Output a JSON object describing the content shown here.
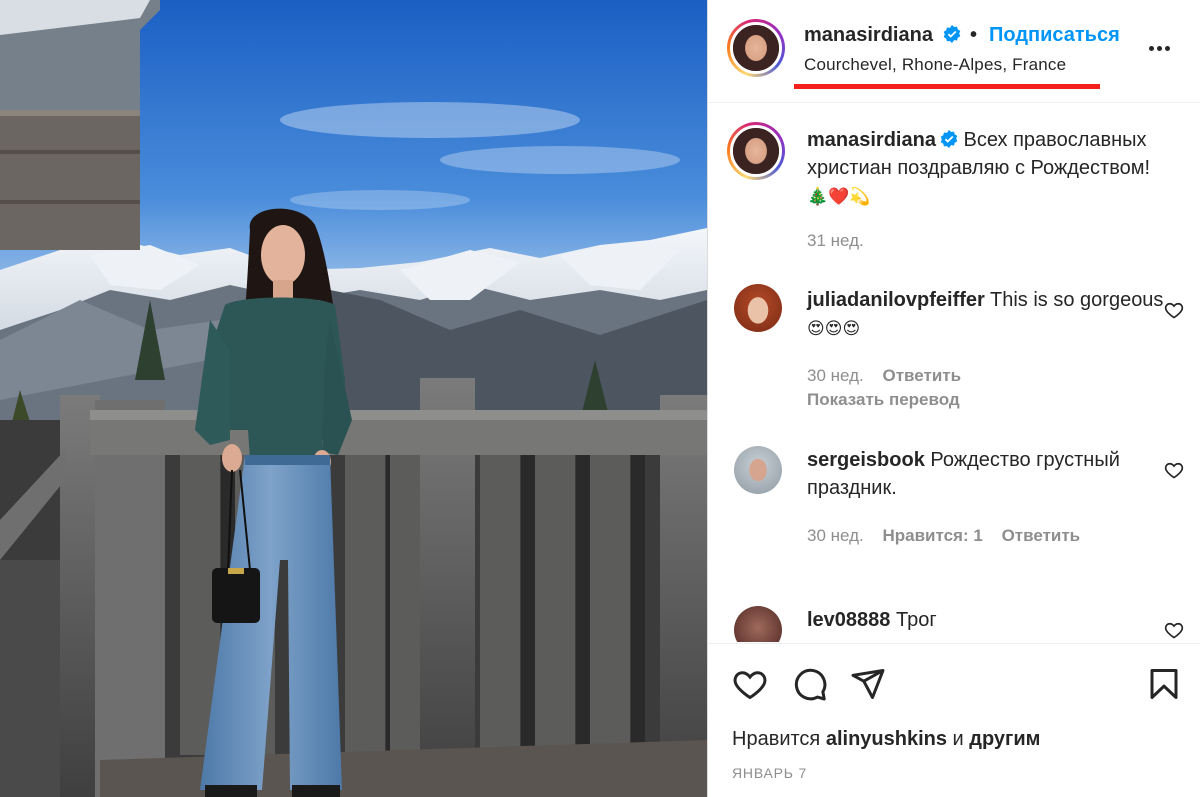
{
  "header": {
    "username": "manasirdiana",
    "separator": "•",
    "follow_label": "Подписаться",
    "location": "Courchevel, Rhone-Alpes, France"
  },
  "caption": {
    "username": "manasirdiana",
    "text": "Всех православных христиан поздравляю с Рождеством!",
    "emojis": "🎄❤️💫",
    "time": "31 нед."
  },
  "comments": [
    {
      "username": "juliadanilovpfeiffer",
      "text": "This is so gorgeous",
      "emojis": "😍😍😍",
      "time": "30 нед.",
      "reply_label": "Ответить",
      "translate_label": "Показать перевод"
    },
    {
      "username": "sergeisbook",
      "text": "Рождество грустный праздник.",
      "time": "30 нед.",
      "likes_label": "Нравится: 1",
      "reply_label": "Ответить"
    },
    {
      "username": "lev08888",
      "text": "Трог"
    }
  ],
  "footer": {
    "likes_prefix": "Нравится",
    "likes_user": "alinyushkins",
    "likes_conj": "и",
    "likes_others": "другим",
    "date": "ЯНВАРЬ 7"
  },
  "icons": {
    "verified": "verified-badge-icon",
    "more": "more-horizontal-icon",
    "like": "heart-icon",
    "comment": "comment-icon",
    "share": "share-icon",
    "save": "bookmark-icon"
  },
  "colors": {
    "accent_blue": "#0095f6",
    "highlight_red": "#f3201c",
    "muted_text": "#8e8e8e"
  }
}
